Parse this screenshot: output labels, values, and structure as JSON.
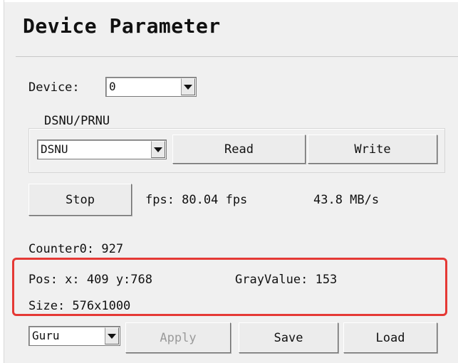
{
  "title": "Device Parameter",
  "device": {
    "label": "Device:",
    "value": "0"
  },
  "dsnu_group": {
    "title": "DSNU/PRNU",
    "mode_value": "DSNU",
    "read_label": "Read",
    "write_label": "Write"
  },
  "acquisition": {
    "stop_label": "Stop",
    "fps_text": "fps: 80.04 fps",
    "bandwidth_text": "43.8 MB/s"
  },
  "counter_text": "Counter0: 927",
  "info": {
    "pos_text": "Pos: x: 409 y:768",
    "gray_text": "GrayValue: 153",
    "size_text": "Size: 576x1000"
  },
  "bottom": {
    "profile_value": "Guru",
    "apply_label": "Apply",
    "save_label": "Save",
    "load_label": "Load"
  },
  "colors": {
    "highlight": "#e53935",
    "background": "#f0f0f0"
  }
}
